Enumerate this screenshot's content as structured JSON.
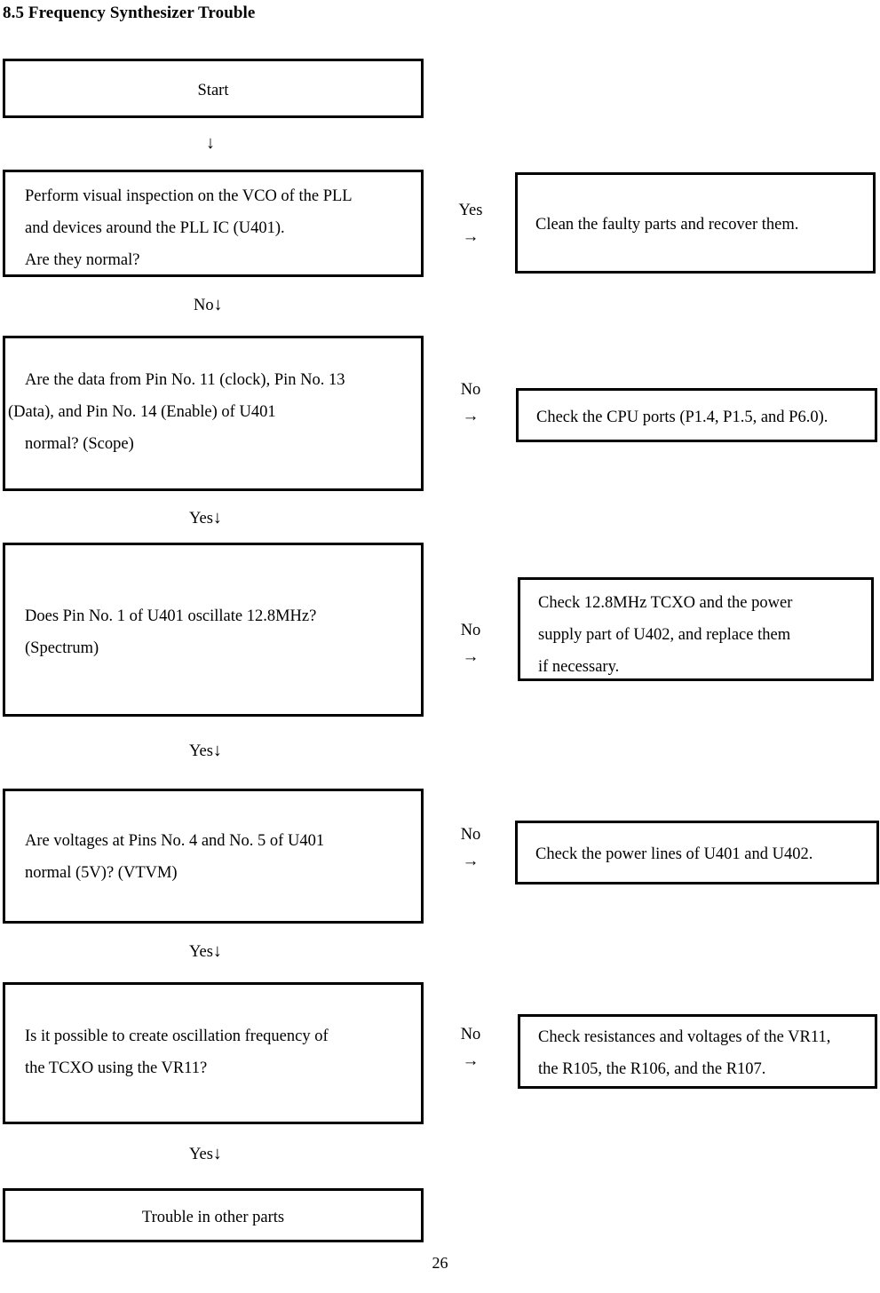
{
  "document": {
    "heading": "8.5 Frequency Synthesizer Trouble",
    "page_number": "26"
  },
  "flow": {
    "start_box": {
      "label": "Start"
    },
    "end_box": {
      "label": "Trouble in other parts"
    },
    "entry_arrow": "↓",
    "steps": [
      {
        "id": "visual-inspection",
        "question_lines": [
          "Perform visual inspection on the VCO of the PLL",
          "and devices around the PLL IC (U401).",
          "Are they normal?"
        ],
        "branch_label": "Yes",
        "branch_arrow": "→",
        "action_lines": [
          "Clean the faulty parts and recover them."
        ],
        "next_label": "No",
        "next_arrow": "↓"
      },
      {
        "id": "pin-data-check",
        "question_lines": [
          "Are the data from Pin No. 11 (clock), Pin No. 13",
          "(Data), and Pin No. 14 (Enable) of U401",
          "normal? (Scope)"
        ],
        "branch_label": "No",
        "branch_arrow": "→",
        "action_lines": [
          "Check the CPU ports (P1.4, P1.5, and P6.0)."
        ],
        "next_label": "Yes",
        "next_arrow": "↓"
      },
      {
        "id": "oscillation-check",
        "question_lines": [
          "Does Pin No. 1 of U401 oscillate 12.8MHz?",
          "(Spectrum)"
        ],
        "branch_label": "No",
        "branch_arrow": "→",
        "action_lines": [
          "Check 12.8MHz TCXO and the power",
          "supply part of U402, and replace them",
          "if necessary."
        ],
        "next_label": "Yes",
        "next_arrow": "↓"
      },
      {
        "id": "voltage-check",
        "question_lines": [
          "Are voltages at Pins No. 4 and No. 5 of U401",
          "normal (5V)? (VTVM)"
        ],
        "branch_label": "No",
        "branch_arrow": "→",
        "action_lines": [
          "Check the power lines of U401 and U402."
        ],
        "next_label": "Yes",
        "next_arrow": "↓"
      },
      {
        "id": "vr11-check",
        "question_lines": [
          "Is it possible to create oscillation frequency of",
          "the TCXO using the VR11?"
        ],
        "branch_label": "No",
        "branch_arrow": "→",
        "action_lines": [
          "Check resistances and voltages of the VR11,",
          "the R105, the R106, and the R107."
        ],
        "next_label": "Yes",
        "next_arrow": "↓"
      }
    ]
  }
}
